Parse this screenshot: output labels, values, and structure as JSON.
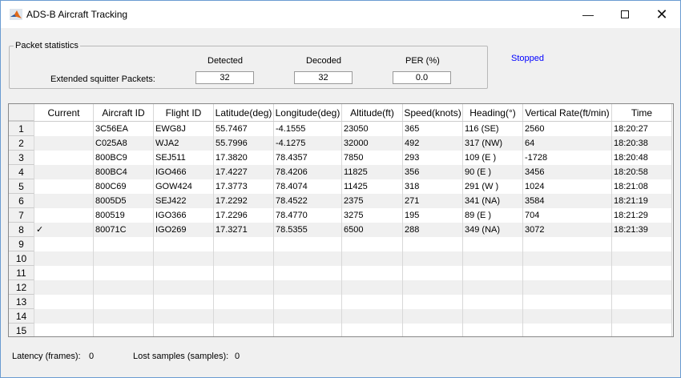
{
  "window": {
    "title": "ADS-B Aircraft Tracking",
    "icon": "matlab-icon",
    "controls": [
      "minimize",
      "maximize",
      "close"
    ]
  },
  "packet_stats": {
    "title": "Packet statistics",
    "row_label": "Extended squitter Packets:",
    "columns": [
      "Detected",
      "Decoded",
      "PER (%)"
    ],
    "values": [
      "32",
      "32",
      "0.0"
    ]
  },
  "status": {
    "text": "Stopped",
    "color": "#0000ff"
  },
  "table": {
    "columns": [
      "Current",
      "Aircraft ID",
      "Flight ID",
      "Latitude(deg)",
      "Longitude(deg)",
      "Altitude(ft)",
      "Speed(knots)",
      "Heading(°)",
      "Vertical Rate(ft/min)",
      "Time"
    ],
    "row_numbers": [
      "1",
      "2",
      "3",
      "4",
      "5",
      "6",
      "7",
      "8",
      "9",
      "10",
      "11",
      "12",
      "13",
      "14",
      "15"
    ],
    "rows": [
      [
        "",
        "3C56EA",
        "EWG8J",
        "55.7467",
        "-4.1555",
        "23050",
        "365",
        "116 (SE)",
        "2560",
        "18:20:27"
      ],
      [
        "",
        "C025A8",
        "WJA2",
        "55.7996",
        "-4.1275",
        "32000",
        "492",
        "317 (NW)",
        "64",
        "18:20:38"
      ],
      [
        "",
        "800BC9",
        "SEJ511",
        "17.3820",
        "78.4357",
        "7850",
        "293",
        "109 (E )",
        "-1728",
        "18:20:48"
      ],
      [
        "",
        "800BC4",
        "IGO466",
        "17.4227",
        "78.4206",
        "11825",
        "356",
        "90 (E )",
        "3456",
        "18:20:58"
      ],
      [
        "",
        "800C69",
        "GOW424",
        "17.3773",
        "78.4074",
        "11425",
        "318",
        "291 (W )",
        "1024",
        "18:21:08"
      ],
      [
        "",
        "8005D5",
        "SEJ422",
        "17.2292",
        "78.4522",
        "2375",
        "271",
        "341 (NA)",
        "3584",
        "18:21:19"
      ],
      [
        "",
        "800519",
        "IGO366",
        "17.2296",
        "78.4770",
        "3275",
        "195",
        "89 (E )",
        "704",
        "18:21:29"
      ],
      [
        "✓",
        "80071C",
        "IGO269",
        "17.3271",
        "78.5355",
        "6500",
        "288",
        "349 (NA)",
        "3072",
        "18:21:39"
      ]
    ]
  },
  "footer": {
    "latency_label": "Latency (frames):",
    "latency_value": "0",
    "lost_label": "Lost samples (samples):",
    "lost_value": "0"
  }
}
